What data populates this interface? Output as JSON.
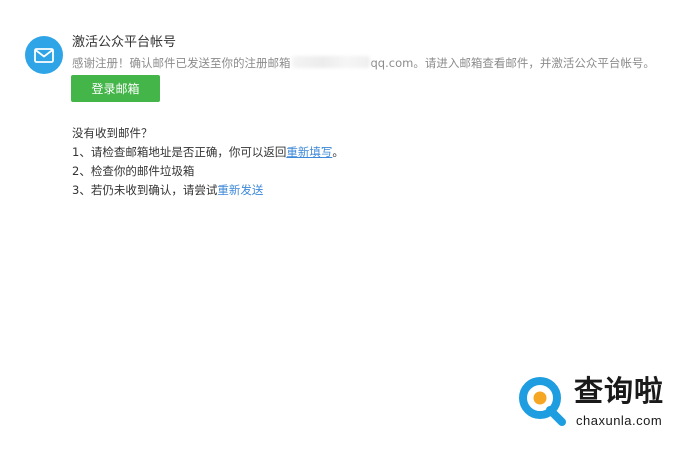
{
  "header": {
    "icon": "mail-icon",
    "icon_color": "#2fa4e7",
    "title": "激活公众平台帐号",
    "subtitle_before": "感谢注册！确认邮件已发送至你的注册邮箱",
    "subtitle_after": "qq.com。请进入邮箱查看邮件，并激活公众平台帐号。"
  },
  "login_button": {
    "label": "登录邮箱",
    "color": "#44b549"
  },
  "help": {
    "question": "没有收到邮件？",
    "items": [
      {
        "text": "1、请检查邮箱地址是否正确，你可以返回",
        "link": "重新填写",
        "suffix": "。"
      },
      {
        "text": "2、检查你的邮件垃圾箱",
        "link": "",
        "suffix": ""
      },
      {
        "text": "3、若仍未收到确认，请尝试",
        "link": "重新发送",
        "suffix": ""
      }
    ],
    "link_color": "#3d88d8"
  },
  "watermark": {
    "brand": "查询啦",
    "domain": "chaxunla.com",
    "logo_colors": [
      "#1e9de0",
      "#f5a623"
    ]
  }
}
